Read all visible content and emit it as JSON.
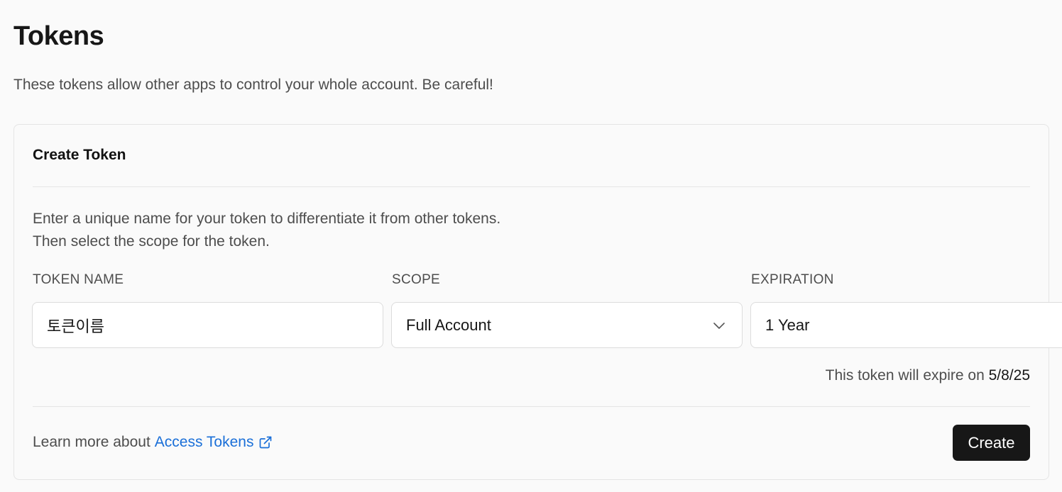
{
  "header": {
    "title": "Tokens",
    "description": "These tokens allow other apps to control your whole account. Be careful!"
  },
  "card": {
    "title": "Create Token",
    "instructions_line1": "Enter a unique name for your token to differentiate it from other tokens.",
    "instructions_line2": "Then select the scope for the token.",
    "token_name": {
      "label": "TOKEN NAME",
      "value": "토큰이름"
    },
    "scope": {
      "label": "SCOPE",
      "selected": "Full Account"
    },
    "expiration": {
      "label": "EXPIRATION",
      "selected": "1 Year"
    },
    "expire_note_prefix": "This token will expire on",
    "expire_date": "5/8/25",
    "footer": {
      "learn_more_prefix": "Learn more about",
      "link_label": "Access Tokens",
      "link_icon": "external-link-icon",
      "create_label": "Create"
    }
  },
  "colors": {
    "link": "#1a6fd8",
    "button_bg": "#171717",
    "page_bg": "#fafafa"
  }
}
